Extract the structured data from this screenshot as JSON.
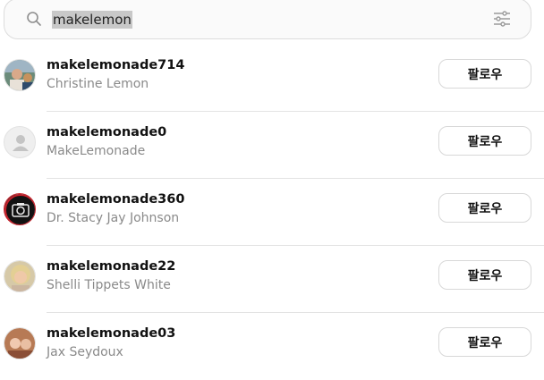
{
  "search": {
    "query": "makelemon",
    "icon": "search-icon",
    "filter_icon": "sliders-icon"
  },
  "results": [
    {
      "username": "makelemonade714",
      "display_name": "Christine Lemon",
      "follow_label": "팔로우"
    },
    {
      "username": "makelemonade0",
      "display_name": "MakeLemonade",
      "follow_label": "팔로우"
    },
    {
      "username": "makelemonade360",
      "display_name": "Dr. Stacy Jay Johnson",
      "follow_label": "팔로우"
    },
    {
      "username": "makelemonade22",
      "display_name": "Shelli Tippets White",
      "follow_label": "팔로우"
    },
    {
      "username": "makelemonade03",
      "display_name": "Jax Seydoux",
      "follow_label": "팔로우"
    }
  ]
}
